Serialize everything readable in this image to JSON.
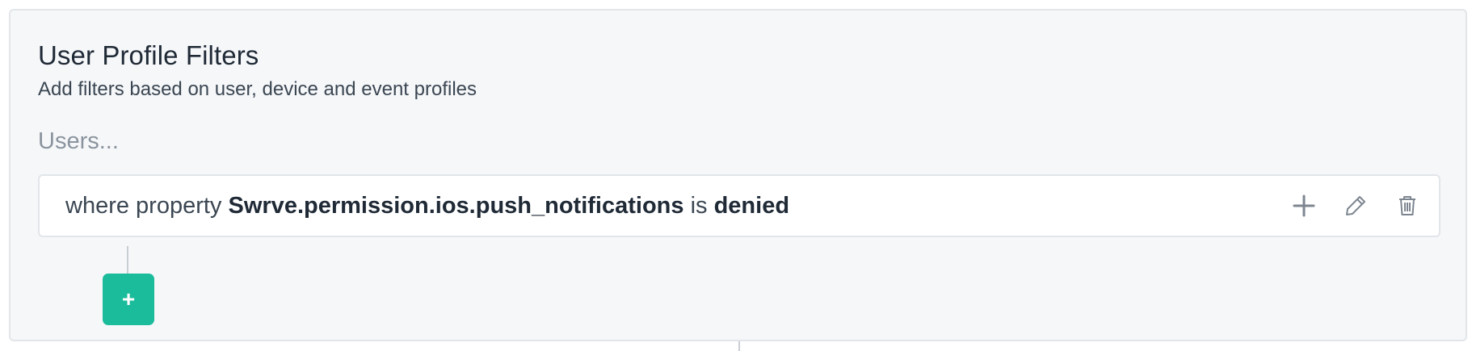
{
  "section": {
    "title": "User Profile Filters",
    "subtitle": "Add filters based on user, device and event profiles",
    "users_label": "Users..."
  },
  "filter": {
    "prefix": "where property",
    "property": "Swrve.permission.ios.push_notifications",
    "operator": "is",
    "value": "denied",
    "actions": [
      {
        "name": "add",
        "icon": "plus-icon"
      },
      {
        "name": "edit",
        "icon": "pencil-icon"
      },
      {
        "name": "delete",
        "icon": "trash-icon"
      }
    ]
  },
  "add_button": {
    "label": "+"
  },
  "colors": {
    "panel_bg": "#f6f7f9",
    "accent": "#1abc9c",
    "border": "#e2e5e9",
    "icon": "#7d8690"
  }
}
